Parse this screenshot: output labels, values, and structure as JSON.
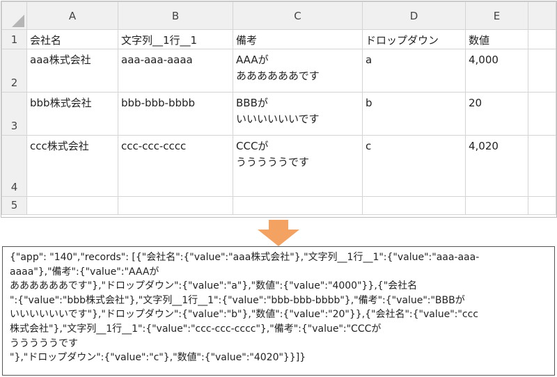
{
  "columns": [
    "A",
    "B",
    "C",
    "D",
    "E"
  ],
  "rows": [
    {
      "num": "1",
      "cells": [
        [
          "会社名"
        ],
        [
          "文字列__1行__1"
        ],
        [
          "備考"
        ],
        [
          "ドロップダウン"
        ],
        [
          "数値"
        ]
      ]
    },
    {
      "num": "2",
      "cells": [
        [
          "aaa株式会社"
        ],
        [
          "aaa-aaa-aaaa"
        ],
        [
          "AAAが",
          "ああああああです"
        ],
        [
          "a"
        ],
        [
          "4,000"
        ]
      ]
    },
    {
      "num": "3",
      "cells": [
        [
          "bbb株式会社"
        ],
        [
          "bbb-bbb-bbbb"
        ],
        [
          "BBBが",
          "いいいいいいです"
        ],
        [
          "b"
        ],
        [
          "20"
        ]
      ]
    },
    {
      "num": "4",
      "cells": [
        [
          "ccc株式会社"
        ],
        [
          "ccc-ccc-cccc"
        ],
        [
          "CCCが",
          "うううううです"
        ],
        [
          "c"
        ],
        [
          "4,020"
        ]
      ]
    },
    {
      "num": "5",
      "cells": [
        [
          ""
        ],
        [
          ""
        ],
        [
          ""
        ],
        [
          ""
        ],
        [
          ""
        ]
      ]
    }
  ],
  "arrow_color": "#f4a261",
  "json_output": {
    "lines": [
      "{\"app\": \"140\",\"records\": [{\"会社名\":{\"value\":\"aaa株式会社\"},\"文字列__1行__1\":{\"value\":\"aaa-aaa-",
      "aaaa\"},\"備考\":{\"value\":\"AAAが",
      "ああああああです\"},\"ドロップダウン\":{\"value\":\"a\"},\"数値\":{\"value\":\"4000\"}},{\"会社名",
      "\":{\"value\":\"bbb株式会社\"},\"文字列__1行__1\":{\"value\":\"bbb-bbb-bbbb\"},\"備考\":{\"value\":\"BBBが",
      "いいいいいいです\"},\"ドロップダウン\":{\"value\":\"b\"},\"数値\":{\"value\":\"20\"}},{\"会社名\":{\"value\":\"ccc",
      "株式会社\"},\"文字列__1行__1\":{\"value\":\"ccc-ccc-cccc\"},\"備考\":{\"value\":\"CCCが",
      "うううううです",
      "\"},\"ドロップダウン\":{\"value\":\"c\"},\"数値\":{\"value\":\"4020\"}}]}"
    ]
  }
}
